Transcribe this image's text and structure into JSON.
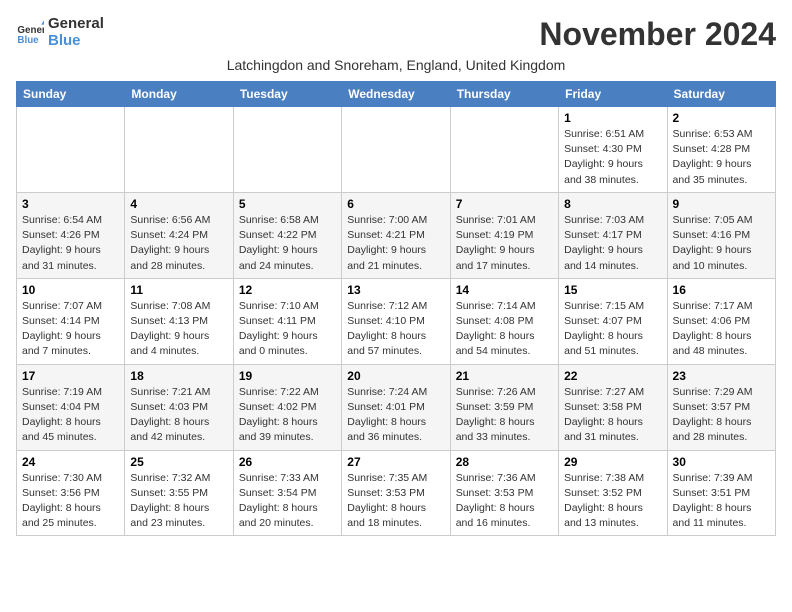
{
  "header": {
    "logo_general": "General",
    "logo_blue": "Blue",
    "month_title": "November 2024",
    "subtitle": "Latchingdon and Snoreham, England, United Kingdom"
  },
  "days_of_week": [
    "Sunday",
    "Monday",
    "Tuesday",
    "Wednesday",
    "Thursday",
    "Friday",
    "Saturday"
  ],
  "weeks": [
    [
      {
        "day": "",
        "info": ""
      },
      {
        "day": "",
        "info": ""
      },
      {
        "day": "",
        "info": ""
      },
      {
        "day": "",
        "info": ""
      },
      {
        "day": "",
        "info": ""
      },
      {
        "day": "1",
        "info": "Sunrise: 6:51 AM\nSunset: 4:30 PM\nDaylight: 9 hours and 38 minutes."
      },
      {
        "day": "2",
        "info": "Sunrise: 6:53 AM\nSunset: 4:28 PM\nDaylight: 9 hours and 35 minutes."
      }
    ],
    [
      {
        "day": "3",
        "info": "Sunrise: 6:54 AM\nSunset: 4:26 PM\nDaylight: 9 hours and 31 minutes."
      },
      {
        "day": "4",
        "info": "Sunrise: 6:56 AM\nSunset: 4:24 PM\nDaylight: 9 hours and 28 minutes."
      },
      {
        "day": "5",
        "info": "Sunrise: 6:58 AM\nSunset: 4:22 PM\nDaylight: 9 hours and 24 minutes."
      },
      {
        "day": "6",
        "info": "Sunrise: 7:00 AM\nSunset: 4:21 PM\nDaylight: 9 hours and 21 minutes."
      },
      {
        "day": "7",
        "info": "Sunrise: 7:01 AM\nSunset: 4:19 PM\nDaylight: 9 hours and 17 minutes."
      },
      {
        "day": "8",
        "info": "Sunrise: 7:03 AM\nSunset: 4:17 PM\nDaylight: 9 hours and 14 minutes."
      },
      {
        "day": "9",
        "info": "Sunrise: 7:05 AM\nSunset: 4:16 PM\nDaylight: 9 hours and 10 minutes."
      }
    ],
    [
      {
        "day": "10",
        "info": "Sunrise: 7:07 AM\nSunset: 4:14 PM\nDaylight: 9 hours and 7 minutes."
      },
      {
        "day": "11",
        "info": "Sunrise: 7:08 AM\nSunset: 4:13 PM\nDaylight: 9 hours and 4 minutes."
      },
      {
        "day": "12",
        "info": "Sunrise: 7:10 AM\nSunset: 4:11 PM\nDaylight: 9 hours and 0 minutes."
      },
      {
        "day": "13",
        "info": "Sunrise: 7:12 AM\nSunset: 4:10 PM\nDaylight: 8 hours and 57 minutes."
      },
      {
        "day": "14",
        "info": "Sunrise: 7:14 AM\nSunset: 4:08 PM\nDaylight: 8 hours and 54 minutes."
      },
      {
        "day": "15",
        "info": "Sunrise: 7:15 AM\nSunset: 4:07 PM\nDaylight: 8 hours and 51 minutes."
      },
      {
        "day": "16",
        "info": "Sunrise: 7:17 AM\nSunset: 4:06 PM\nDaylight: 8 hours and 48 minutes."
      }
    ],
    [
      {
        "day": "17",
        "info": "Sunrise: 7:19 AM\nSunset: 4:04 PM\nDaylight: 8 hours and 45 minutes."
      },
      {
        "day": "18",
        "info": "Sunrise: 7:21 AM\nSunset: 4:03 PM\nDaylight: 8 hours and 42 minutes."
      },
      {
        "day": "19",
        "info": "Sunrise: 7:22 AM\nSunset: 4:02 PM\nDaylight: 8 hours and 39 minutes."
      },
      {
        "day": "20",
        "info": "Sunrise: 7:24 AM\nSunset: 4:01 PM\nDaylight: 8 hours and 36 minutes."
      },
      {
        "day": "21",
        "info": "Sunrise: 7:26 AM\nSunset: 3:59 PM\nDaylight: 8 hours and 33 minutes."
      },
      {
        "day": "22",
        "info": "Sunrise: 7:27 AM\nSunset: 3:58 PM\nDaylight: 8 hours and 31 minutes."
      },
      {
        "day": "23",
        "info": "Sunrise: 7:29 AM\nSunset: 3:57 PM\nDaylight: 8 hours and 28 minutes."
      }
    ],
    [
      {
        "day": "24",
        "info": "Sunrise: 7:30 AM\nSunset: 3:56 PM\nDaylight: 8 hours and 25 minutes."
      },
      {
        "day": "25",
        "info": "Sunrise: 7:32 AM\nSunset: 3:55 PM\nDaylight: 8 hours and 23 minutes."
      },
      {
        "day": "26",
        "info": "Sunrise: 7:33 AM\nSunset: 3:54 PM\nDaylight: 8 hours and 20 minutes."
      },
      {
        "day": "27",
        "info": "Sunrise: 7:35 AM\nSunset: 3:53 PM\nDaylight: 8 hours and 18 minutes."
      },
      {
        "day": "28",
        "info": "Sunrise: 7:36 AM\nSunset: 3:53 PM\nDaylight: 8 hours and 16 minutes."
      },
      {
        "day": "29",
        "info": "Sunrise: 7:38 AM\nSunset: 3:52 PM\nDaylight: 8 hours and 13 minutes."
      },
      {
        "day": "30",
        "info": "Sunrise: 7:39 AM\nSunset: 3:51 PM\nDaylight: 8 hours and 11 minutes."
      }
    ]
  ]
}
